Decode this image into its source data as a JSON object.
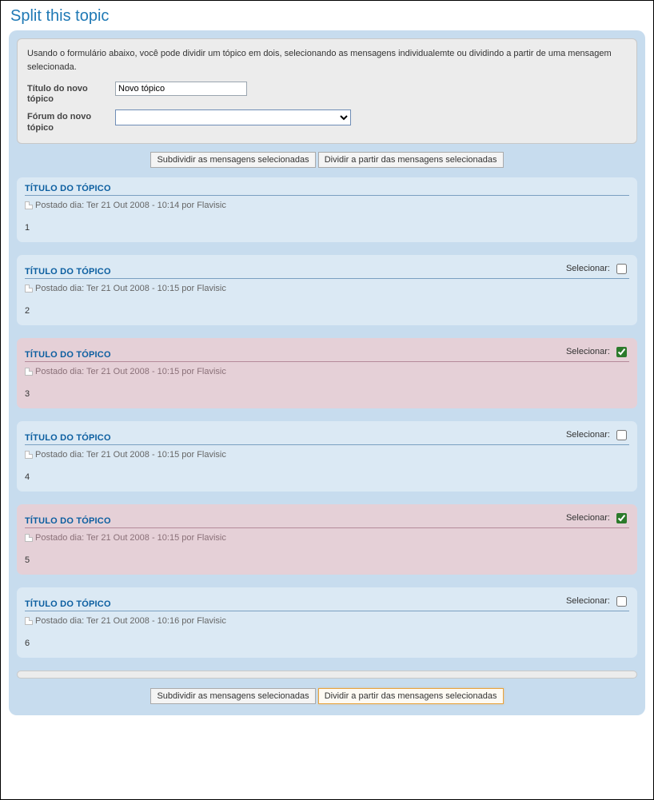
{
  "page_title": "Split this topic",
  "intro": "Usando o formulário abaixo, você pode dividir um tópico em dois, selecionando as mensagens individualemte ou dividindo a partir de uma mensagem selecionada.",
  "form": {
    "title_label": "Título do novo tópico",
    "title_value": "Novo tópico",
    "forum_label": "Fórum do novo tópico",
    "forum_value": ""
  },
  "buttons": {
    "split_selected": "Subdividir as mensagens selecionadas",
    "split_from": "Dividir a partir das mensagens selecionadas"
  },
  "labels": {
    "select": "Selecionar:"
  },
  "posts": [
    {
      "title": "TÍTULO DO TÓPICO",
      "meta": "Postado dia: Ter 21 Out 2008 - 10:14 por Flavisic",
      "body": "1",
      "selectable": false,
      "selected": false
    },
    {
      "title": "TÍTULO DO TÓPICO",
      "meta": "Postado dia: Ter 21 Out 2008 - 10:15 por Flavisic",
      "body": "2",
      "selectable": true,
      "selected": false
    },
    {
      "title": "TÍTULO DO TÓPICO",
      "meta": "Postado dia: Ter 21 Out 2008 - 10:15 por Flavisic",
      "body": "3",
      "selectable": true,
      "selected": true
    },
    {
      "title": "TÍTULO DO TÓPICO",
      "meta": "Postado dia: Ter 21 Out 2008 - 10:15 por Flavisic",
      "body": "4",
      "selectable": true,
      "selected": false
    },
    {
      "title": "TÍTULO DO TÓPICO",
      "meta": "Postado dia: Ter 21 Out 2008 - 10:15 por Flavisic",
      "body": "5",
      "selectable": true,
      "selected": true
    },
    {
      "title": "TÍTULO DO TÓPICO",
      "meta": "Postado dia: Ter 21 Out 2008 - 10:16 por Flavisic",
      "body": "6",
      "selectable": true,
      "selected": false
    }
  ]
}
